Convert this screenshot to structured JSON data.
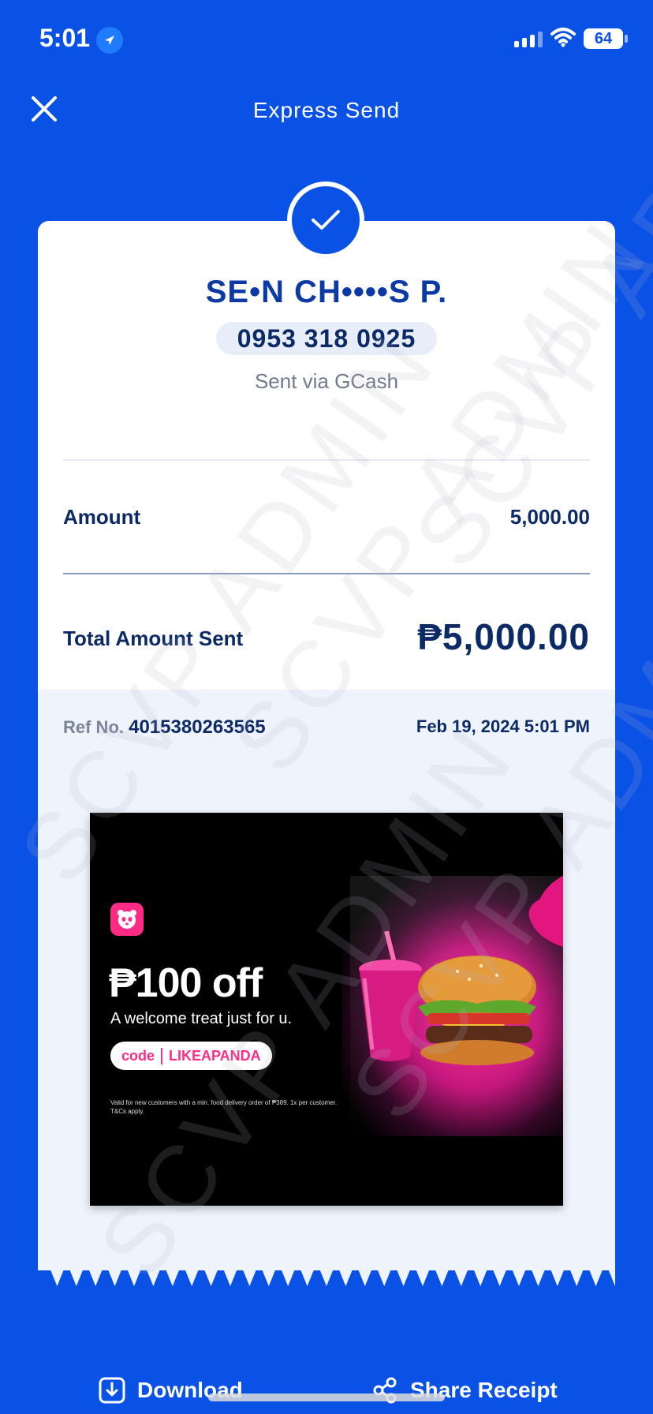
{
  "status_bar": {
    "time": "5:01",
    "battery": "64"
  },
  "header": {
    "title": "Express Send",
    "close_icon": "close-icon"
  },
  "receipt": {
    "recipient_name": "SE•N CH••••S P.",
    "recipient_phone": "0953 318 0925",
    "sent_via": "Sent via GCash",
    "amount_label": "Amount",
    "amount_value": "5,000.00",
    "total_label": "Total Amount Sent",
    "total_value": "₱5,000.00",
    "ref_label": "Ref No.",
    "ref_number": "4015380263565",
    "date_time": "Feb 19, 2024 5:01 PM"
  },
  "ad": {
    "headline": "₱100 off",
    "subtitle": "A welcome treat just for u.",
    "code_word": "code",
    "code_value": "LIKEAPANDA",
    "fine_print": "Valid for new customers with a min. food delivery order of ₱389. 1x per customer. T&Cs apply."
  },
  "actions": {
    "download_label": "Download",
    "share_label": "Share Receipt"
  },
  "watermark_text": "SCVP ADMIN",
  "colors": {
    "brand_blue": "#0a52e6",
    "navy_text": "#0b2a66",
    "pink": "#ff2b85"
  }
}
